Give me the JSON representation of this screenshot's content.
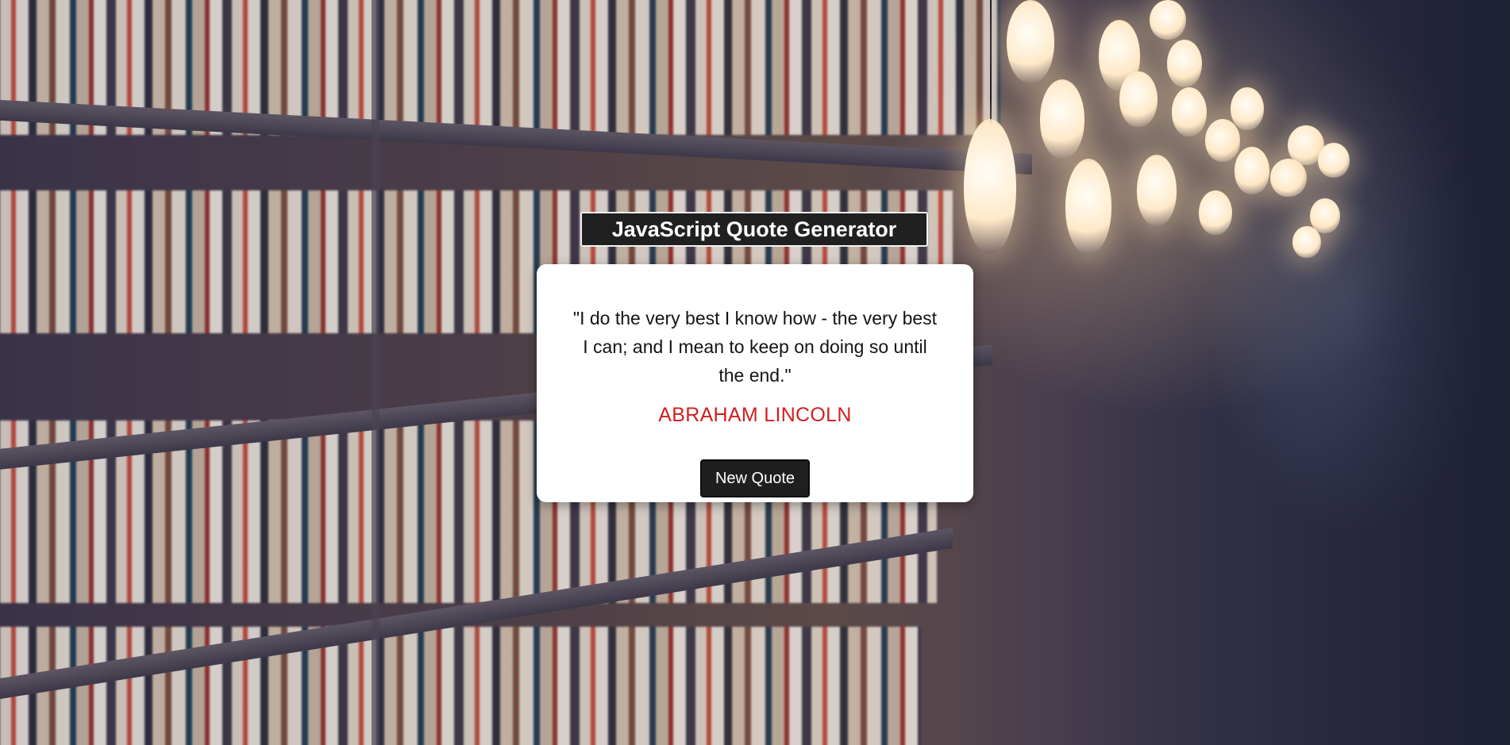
{
  "header": {
    "title": "JavaScript Quote Generator"
  },
  "quote": {
    "text": "\"I do the very best I know how - the very best I can; and I mean to keep on doing so until the end.\"",
    "author": "ABRAHAM LINCOLN"
  },
  "actions": {
    "new_quote_label": "New Quote"
  },
  "colors": {
    "title_bg": "#202020",
    "card_bg": "#ffffff",
    "author": "#d21f1f",
    "button_bg": "#1f1f1f"
  },
  "icons": {
    "background": "library-bookshelves-photo"
  }
}
